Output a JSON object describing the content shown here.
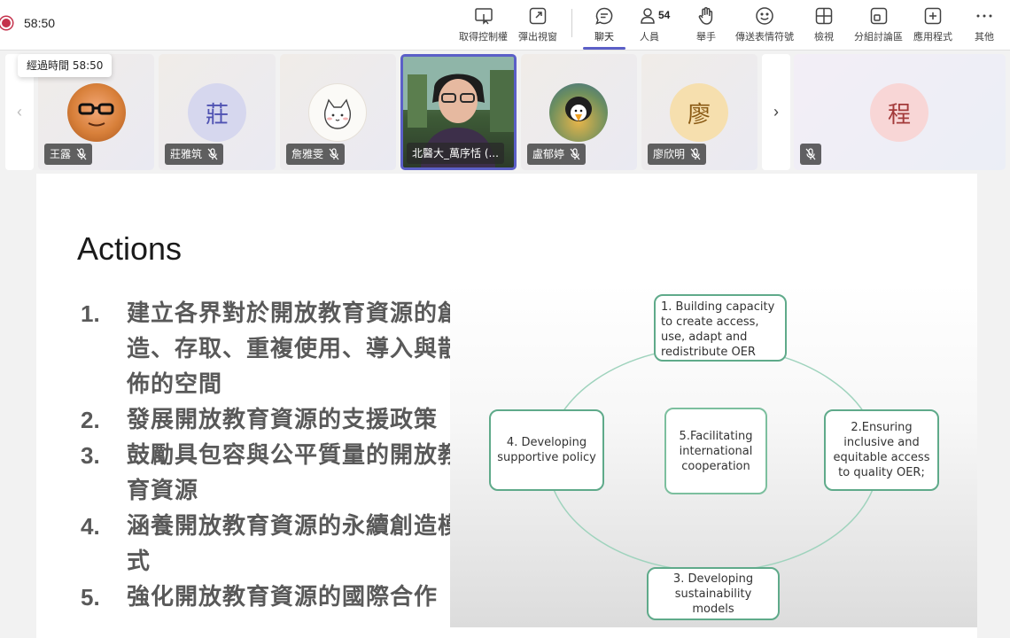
{
  "timer": "58:50",
  "tooltip": "經過時間 58:50",
  "toolbar": {
    "take_control": "取得控制權",
    "popout": "彈出視窗",
    "chat": "聊天",
    "people": "人員",
    "people_count": "54",
    "raise_hand": "舉手",
    "reactions": "傳送表情符號",
    "view": "檢視",
    "breakout": "分組討論區",
    "apps": "應用程式",
    "more": "其他"
  },
  "participants": [
    {
      "name": "王露",
      "initial": ""
    },
    {
      "name": "莊雅筑",
      "initial": "莊"
    },
    {
      "name": "詹雅雯",
      "initial": ""
    },
    {
      "name": "北醫大_萬序恬 (...",
      "initial": ""
    },
    {
      "name": "盧郁婷",
      "initial": ""
    },
    {
      "name": "廖欣明",
      "initial": "廖"
    },
    {
      "name": "",
      "initial": "程"
    }
  ],
  "slide": {
    "title": "Actions",
    "actions": [
      {
        "num": "1.",
        "text": "建立各界對於開放教育資源的創造、存取、重複使用、導入與散佈的空間"
      },
      {
        "num": "2.",
        "text": "發展開放教育資源的支援政策"
      },
      {
        "num": "3.",
        "text": "鼓勵具包容與公平質量的開放教育資源"
      },
      {
        "num": "4.",
        "text": "涵養開放教育資源的永續創造模式"
      },
      {
        "num": "5.",
        "text": "強化開放教育資源的國際合作"
      }
    ],
    "diagram": {
      "box1": "1. Building capacity to create access, use, adapt and redistribute OER",
      "box2": "2.Ensuring inclusive and equitable access to quality OER;",
      "box3": "3. Developing sustainability models",
      "box4": "4. Developing supportive policy",
      "box5": "5.Facilitating international cooperation"
    }
  },
  "colors": {
    "accent": "#5b5fc7",
    "record": "#c4314b",
    "diagram_green": "#5faa8a"
  }
}
